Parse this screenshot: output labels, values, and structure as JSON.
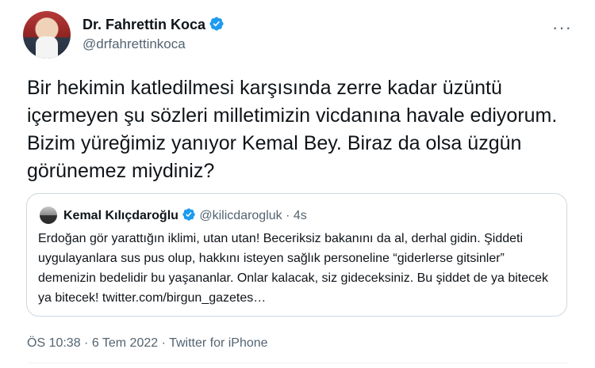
{
  "author": {
    "name": "Dr. Fahrettin Koca",
    "handle": "@drfahrettinkoca"
  },
  "more_label": "···",
  "tweet": {
    "text": "Bir hekimin katledilmesi karşısında zerre kadar üzüntü içermeyen şu sözleri milletimizin vicdanına havale ediyorum. Bizim yüreğimiz yanıyor Kemal Bey. Biraz da olsa üzgün görünemez miydiniz?"
  },
  "quoted": {
    "name": "Kemal Kılıçdaroğlu",
    "handle": "@kilicdarogluk",
    "separator": "·",
    "time": "4s",
    "text": "Erdoğan gör yarattığın iklimi, utan utan! Beceriksiz bakanını da al, derhal gidin. Şiddeti uygulayanlara sus pus olup, hakkını isteyen sağlık personeline “giderlerse gitsinler” demenizin bedelidir bu yaşananlar. Onlar kalacak, siz gideceksiniz. Bu şiddet de ya bitecek ya bitecek! twitter.com/birgun_gazetes…"
  },
  "footer": {
    "meta": "ÖS 10:38 · 6 Tem 2022 · Twitter for iPhone"
  },
  "colors": {
    "verified": "#1d9bf0",
    "secondary_text": "#536471",
    "border": "#cfd9de"
  }
}
